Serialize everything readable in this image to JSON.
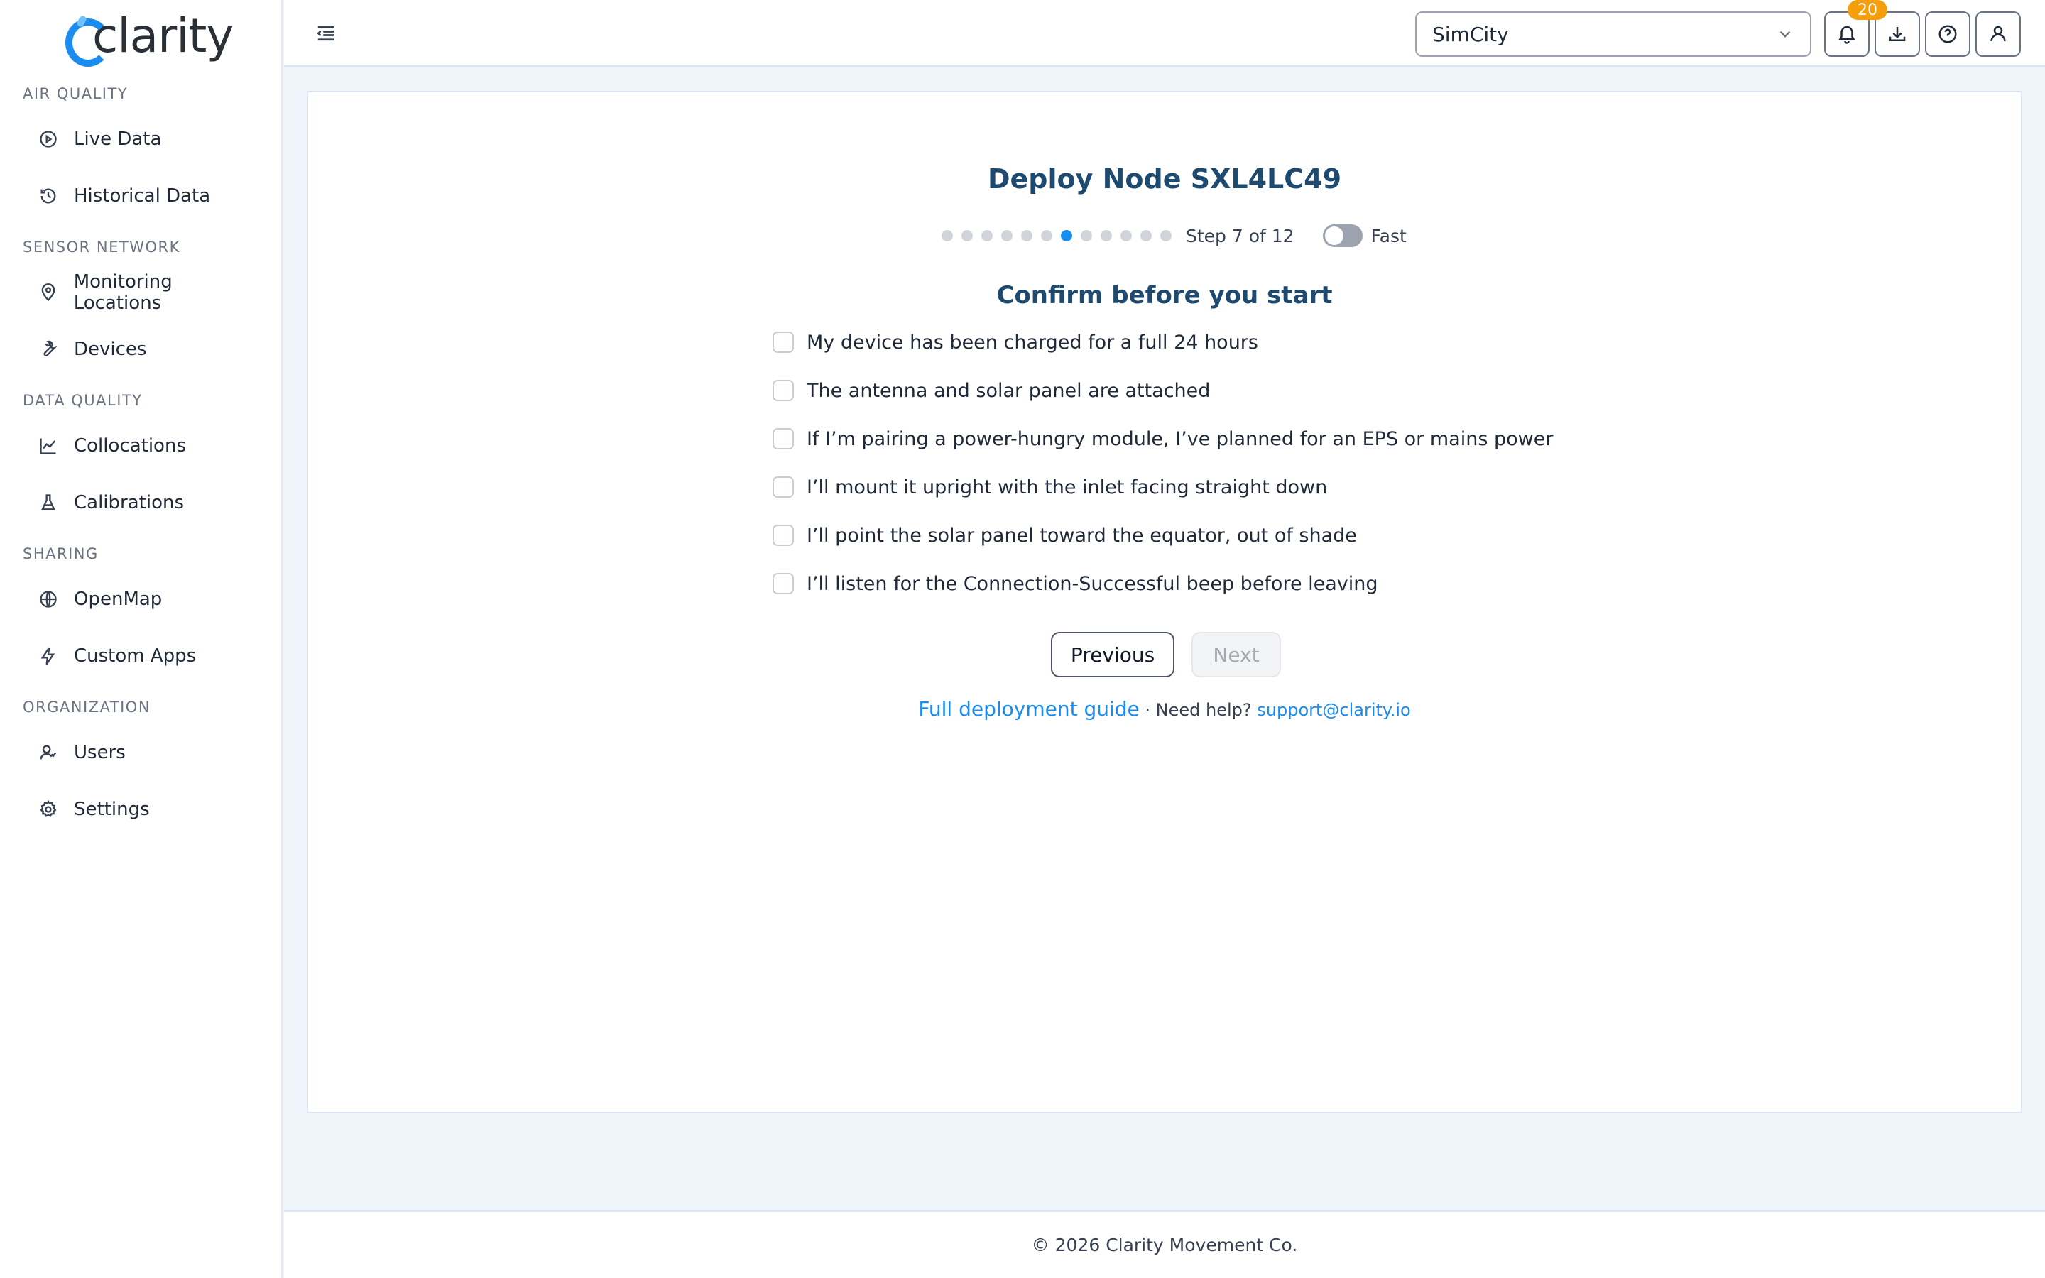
{
  "app": {
    "logo_text": "clarity",
    "brand_color": "#1a8cf0"
  },
  "sidebar": {
    "sections": [
      {
        "title": "AIR QUALITY",
        "items": [
          {
            "label": "Live Data",
            "icon": "play-circle-icon"
          },
          {
            "label": "Historical Data",
            "icon": "clock-icon"
          }
        ]
      },
      {
        "title": "SENSOR NETWORK",
        "items": [
          {
            "label": "Monitoring Locations",
            "icon": "map-pin-icon"
          },
          {
            "label": "Devices",
            "icon": "wrench-icon"
          }
        ]
      },
      {
        "title": "DATA QUALITY",
        "items": [
          {
            "label": "Collocations",
            "icon": "line-chart-icon"
          },
          {
            "label": "Calibrations",
            "icon": "flask-icon"
          }
        ]
      },
      {
        "title": "SHARING",
        "items": [
          {
            "label": "OpenMap",
            "icon": "globe-icon"
          },
          {
            "label": "Custom Apps",
            "icon": "lightning-icon"
          }
        ]
      },
      {
        "title": "ORGANIZATION",
        "items": [
          {
            "label": "Users",
            "icon": "users-icon"
          },
          {
            "label": "Settings",
            "icon": "gear-icon"
          }
        ]
      }
    ]
  },
  "header": {
    "org_select_value": "SimCity",
    "notification_count": "20"
  },
  "wizard": {
    "title": "Deploy Node SXL4LC49",
    "total_steps": 12,
    "current_step": 7,
    "step_text": "Step 7 of 12",
    "fast_toggle_label": "Fast",
    "fast_toggle_on": false,
    "subtitle": "Confirm before you start",
    "checklist": [
      {
        "label": "My device has been charged for a full 24 hours",
        "checked": false
      },
      {
        "label": "The antenna and solar panel are attached",
        "checked": false
      },
      {
        "label": "If I’m pairing a power-hungry module, I’ve planned for an EPS or mains power",
        "checked": false
      },
      {
        "label": "I’ll mount it upright with the inlet facing straight down",
        "checked": false
      },
      {
        "label": "I’ll point the solar panel toward the equator, out of shade",
        "checked": false
      },
      {
        "label": "I’ll listen for the Connection-Successful beep before leaving",
        "checked": false
      }
    ],
    "previous_label": "Previous",
    "next_label": "Next",
    "guide_link": "Full deployment guide",
    "separator": " · Need help? ",
    "support_email": "support@clarity.io"
  },
  "footer": {
    "copyright": "© 2026 Clarity Movement Co."
  }
}
